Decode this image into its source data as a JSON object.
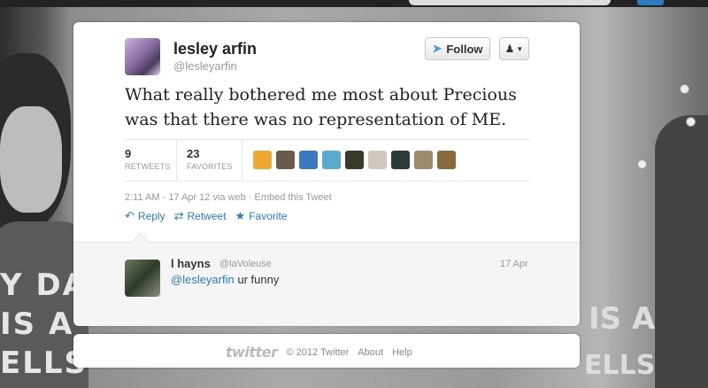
{
  "tweet": {
    "user": {
      "name": "lesley arfin",
      "handle": "@lesleyarfin"
    },
    "follow_label": "Follow",
    "text": "What really bothered me most about Precious was that there was no representation of ME.",
    "stats": {
      "retweets": {
        "count": "9",
        "label": "RETWEETS"
      },
      "favorites": {
        "count": "23",
        "label": "FAVORITES"
      }
    },
    "favoriter_avatar_colors": [
      "#f0a830",
      "#6a5a4a",
      "#3a7abf",
      "#5aaad0",
      "#3a3a2a",
      "#d0c8b8",
      "#2a3a3a",
      "#a08a6a",
      "#8a6a3a"
    ],
    "meta": "2:11 AM - 17 Apr 12 via web · Embed this Tweet",
    "actions": {
      "reply": "Reply",
      "retweet": "Retweet",
      "favorite": "Favorite"
    }
  },
  "reply": {
    "name": "l hayns",
    "handle": "@laVoleuse",
    "date": "17 Apr",
    "mention": "@lesleyarfin",
    "text": " ur funny"
  },
  "footer": {
    "logo": "twitter",
    "copyright": "© 2012 Twitter",
    "about": "About",
    "help": "Help"
  },
  "colors": {
    "link": "#2b7bb9",
    "accent_blue": "#4a9fd8"
  }
}
